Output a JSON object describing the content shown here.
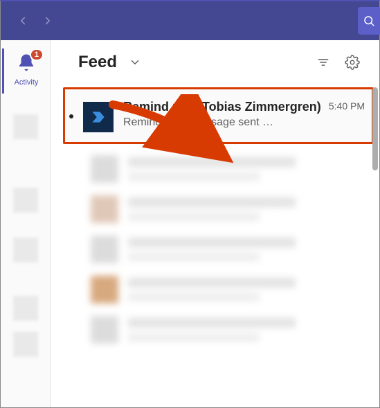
{
  "nav": {
    "back_icon": "chevron-left",
    "forward_icon": "chevron-right",
    "search_icon": "search"
  },
  "apprail": {
    "activity": {
      "label": "Activity",
      "badge": "1",
      "icon": "bell"
    }
  },
  "header": {
    "title": "Feed",
    "dropdown_icon": "chevron-down",
    "filter_icon": "filter",
    "settings_icon": "gear"
  },
  "feed": {
    "items": [
      {
        "title": "Remind me! (Tobias Zimmergren)",
        "time": "5:40 PM",
        "preview": "Reminder for message sent …",
        "avatar_color": "#0f2a4a"
      }
    ]
  },
  "annotation": {
    "highlight_color": "#d83b01"
  }
}
